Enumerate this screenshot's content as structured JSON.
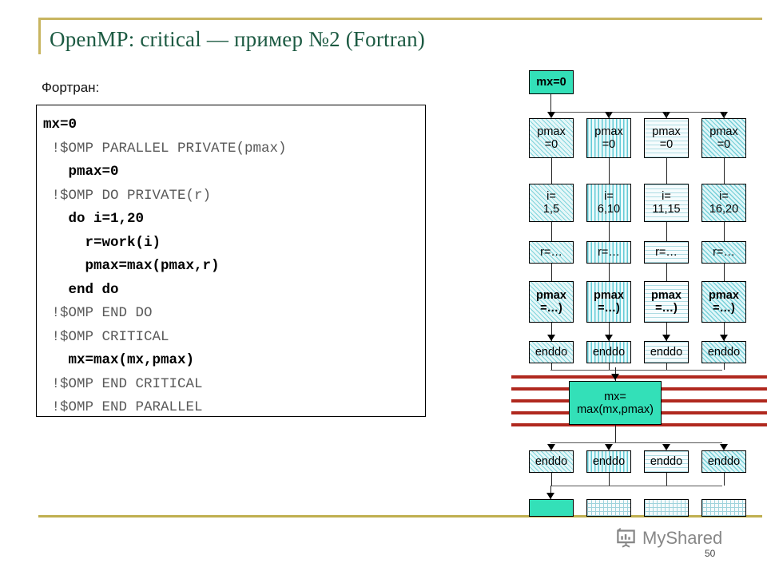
{
  "slide": {
    "title": "OpenMP: critical — пример №2 (Fortran)",
    "page_number": "50",
    "accent_gold": "#C8B560",
    "title_color": "#1C5A42"
  },
  "left": {
    "lang_label": "Фортран:",
    "code_lines": [
      {
        "text": "mx=0",
        "kind": "code"
      },
      {
        "text": " !$OMP PARALLEL PRIVATE(pmax)",
        "kind": "directive"
      },
      {
        "text": "   pmax=0",
        "kind": "code"
      },
      {
        "text": " !$OMP DO PRIVATE(r)",
        "kind": "directive"
      },
      {
        "text": "   do i=1,20",
        "kind": "code"
      },
      {
        "text": "     r=work(i)",
        "kind": "code"
      },
      {
        "text": "     pmax=max(pmax,r)",
        "kind": "code"
      },
      {
        "text": "   end do",
        "kind": "code"
      },
      {
        "text": " !$OMP END DO",
        "kind": "directive"
      },
      {
        "text": " !$OMP CRITICAL",
        "kind": "directive"
      },
      {
        "text": "   mx=max(mx,pmax)",
        "kind": "code"
      },
      {
        "text": " !$OMP END CRITICAL",
        "kind": "directive"
      },
      {
        "text": " !$OMP END PARALLEL",
        "kind": "directive"
      }
    ]
  },
  "diagram": {
    "master_node": "mx=0",
    "critical_node_line1": "mx=",
    "critical_node_line2": "max(mx,pmax)",
    "critical_bar_color": "#B0281E",
    "solid_fill_color": "#33E0B8",
    "threads": [
      {
        "fill": "fill-diag",
        "pmax_l1": "pmax",
        "pmax_l2": "=0",
        "range_l1": "i=",
        "range_l2": "1,5",
        "work": "r=…",
        "reduce_l1": "pmax",
        "reduce_l2": "=…)",
        "enddo_top": "enddo",
        "enddo_bottom": "enddo"
      },
      {
        "fill": "fill-vert",
        "pmax_l1": "pmax",
        "pmax_l2": "=0",
        "range_l1": "i=",
        "range_l2": "6,10",
        "work": "r=…",
        "reduce_l1": "pmax",
        "reduce_l2": "=…)",
        "enddo_top": "enddo",
        "enddo_bottom": "enddo"
      },
      {
        "fill": "fill-dot",
        "pmax_l1": "pmax",
        "pmax_l2": "=0",
        "range_l1": "i=",
        "range_l2": "11,15",
        "work": "r=…",
        "reduce_l1": "pmax",
        "reduce_l2": "=…)",
        "enddo_top": "enddo",
        "enddo_bottom": "enddo"
      },
      {
        "fill": "fill-diag2",
        "pmax_l1": "pmax",
        "pmax_l2": "=0",
        "range_l1": "i=",
        "range_l2": "16,20",
        "work": "r=…",
        "reduce_l1": "pmax",
        "reduce_l2": "=…)",
        "enddo_top": "enddo",
        "enddo_bottom": "enddo"
      }
    ]
  },
  "footer": {
    "watermark_text": "MyShared",
    "watermark_icon": "presentation-chart-icon"
  }
}
